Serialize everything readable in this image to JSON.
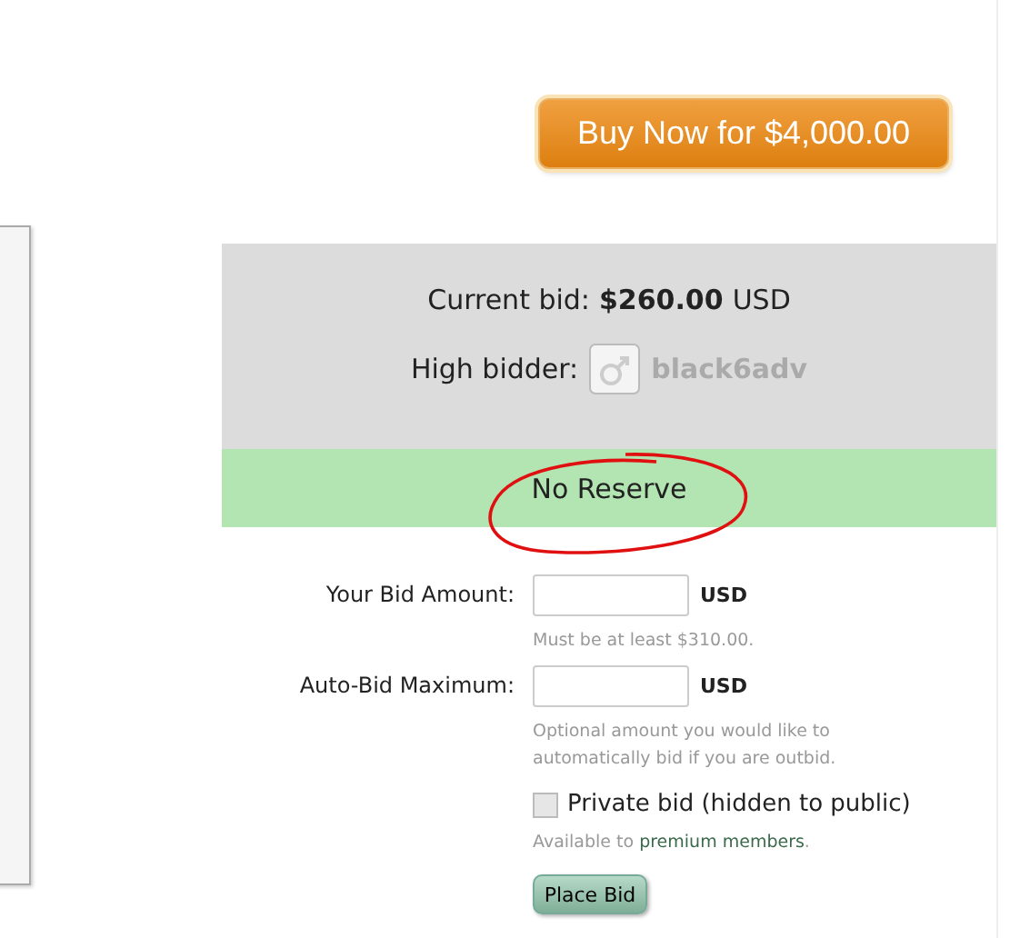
{
  "buy_now_button": "Buy Now for $4,000.00",
  "current_bid": {
    "label": "Current bid:",
    "amount": "$260.00",
    "currency": "USD"
  },
  "high_bidder": {
    "label": "High bidder:",
    "username": "black6adv"
  },
  "reserve_status": "No Reserve",
  "fields": [
    {
      "label": "Your Bid Amount:",
      "currency": "USD",
      "hint": "Must be at least $310.00."
    },
    {
      "label": "Auto-Bid Maximum:",
      "currency": "USD",
      "hint": "Optional amount you would like to automatically bid if you are outbid."
    }
  ],
  "private_bid": {
    "label": "Private bid (hidden to public)",
    "checked": false
  },
  "premium_note": {
    "text": "Available to",
    "link": "premium members",
    "end": "."
  },
  "submit_button": "Place Bid"
}
